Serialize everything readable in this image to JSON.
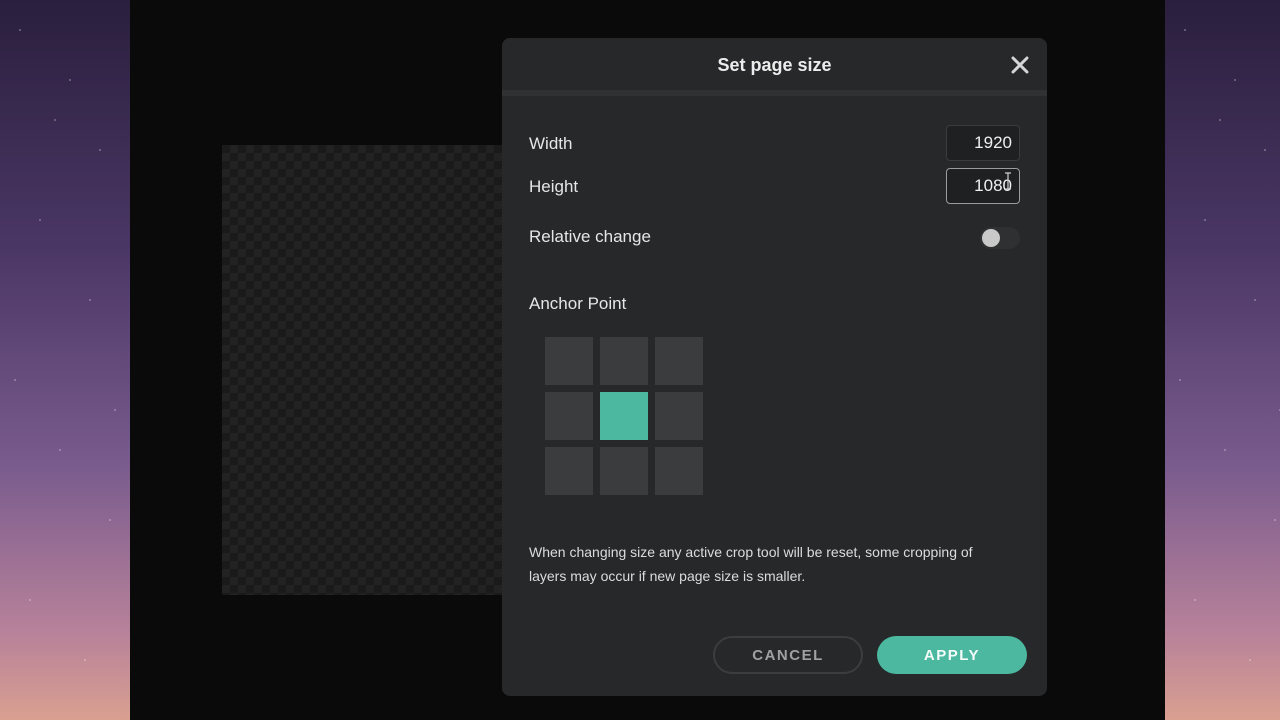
{
  "dialog": {
    "title": "Set page size",
    "close_icon": "close-icon",
    "width_label": "Width",
    "width_value": "1920",
    "height_label": "Height",
    "height_value": "1080",
    "relative_change_label": "Relative change",
    "relative_change_on": false,
    "anchor_title": "Anchor Point",
    "anchor_selected": "center",
    "note": "When changing size any active crop tool will be reset, some cropping of layers may occur if new page size is smaller.",
    "cancel_label": "CANCEL",
    "apply_label": "APPLY"
  },
  "colors": {
    "accent": "#4bb89f",
    "dialog_bg": "#262829",
    "anchor_cell": "#3a3c3d"
  }
}
